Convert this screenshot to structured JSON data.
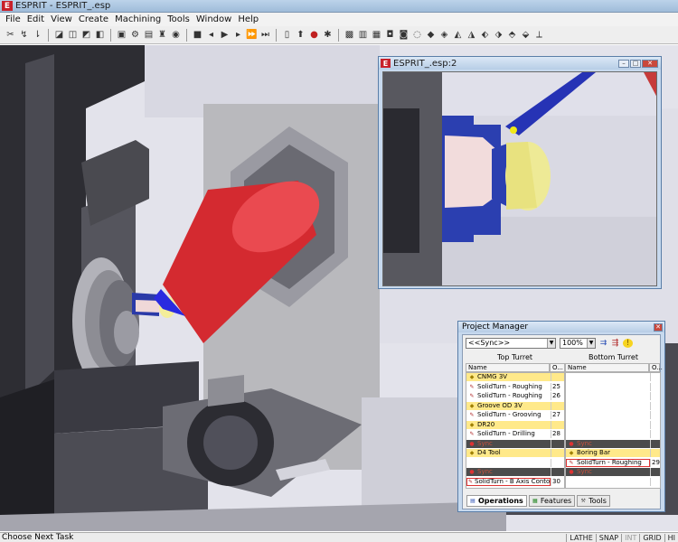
{
  "app": {
    "badge": "E",
    "title": "ESPRIT - ESPRIT_.esp"
  },
  "menu": [
    "File",
    "Edit",
    "View",
    "Create",
    "Machining",
    "Tools",
    "Window",
    "Help"
  ],
  "subwindow": {
    "title": "ESPRIT_.esp:2"
  },
  "project_manager": {
    "title": "Project Manager",
    "sync_select": "<<Sync>>",
    "zoom_select": "100%",
    "top_turret": {
      "label": "Top Turret",
      "columns": [
        "Name",
        "O..."
      ],
      "rows": [
        {
          "kind": "tool",
          "name": "CNMG 3V",
          "order": ""
        },
        {
          "kind": "op",
          "name": "SolidTurn - Roughing",
          "order": "25"
        },
        {
          "kind": "op",
          "name": "SolidTurn - Roughing",
          "order": "26"
        },
        {
          "kind": "tool",
          "name": "Groove OD 3V",
          "order": ""
        },
        {
          "kind": "op",
          "name": "SolidTurn - Grooving",
          "order": "27"
        },
        {
          "kind": "tool",
          "name": "DR20",
          "order": ""
        },
        {
          "kind": "op",
          "name": "SolidTurn - Drilling",
          "order": "28"
        },
        {
          "kind": "sync",
          "name": "Sync",
          "order": ""
        },
        {
          "kind": "tool",
          "name": "D4 Tool",
          "order": ""
        },
        {
          "kind": "blank",
          "name": "",
          "order": ""
        },
        {
          "kind": "sync",
          "name": "Sync",
          "order": ""
        },
        {
          "kind": "sel",
          "name": "SolidTurn - B Axis Contouri...",
          "order": "30"
        }
      ]
    },
    "bottom_turret": {
      "label": "Bottom Turret",
      "columns": [
        "Name",
        "O..."
      ],
      "rows": [
        {
          "kind": "blank",
          "name": "",
          "order": ""
        },
        {
          "kind": "blank",
          "name": "",
          "order": ""
        },
        {
          "kind": "blank",
          "name": "",
          "order": ""
        },
        {
          "kind": "blank",
          "name": "",
          "order": ""
        },
        {
          "kind": "blank",
          "name": "",
          "order": ""
        },
        {
          "kind": "blank",
          "name": "",
          "order": ""
        },
        {
          "kind": "blank",
          "name": "",
          "order": ""
        },
        {
          "kind": "sync",
          "name": "Sync",
          "order": ""
        },
        {
          "kind": "tool",
          "name": "Boring Bar",
          "order": ""
        },
        {
          "kind": "sel",
          "name": "SolidTurn - Roughing",
          "order": "29"
        },
        {
          "kind": "sync",
          "name": "Sync",
          "order": ""
        },
        {
          "kind": "blank",
          "name": "",
          "order": ""
        }
      ]
    },
    "tabs": [
      "Operations",
      "Features",
      "Tools"
    ]
  },
  "status": {
    "message": "Choose Next Task",
    "indicators": [
      "LATHE",
      "SNAP",
      "INT",
      "GRID",
      "HI"
    ]
  }
}
